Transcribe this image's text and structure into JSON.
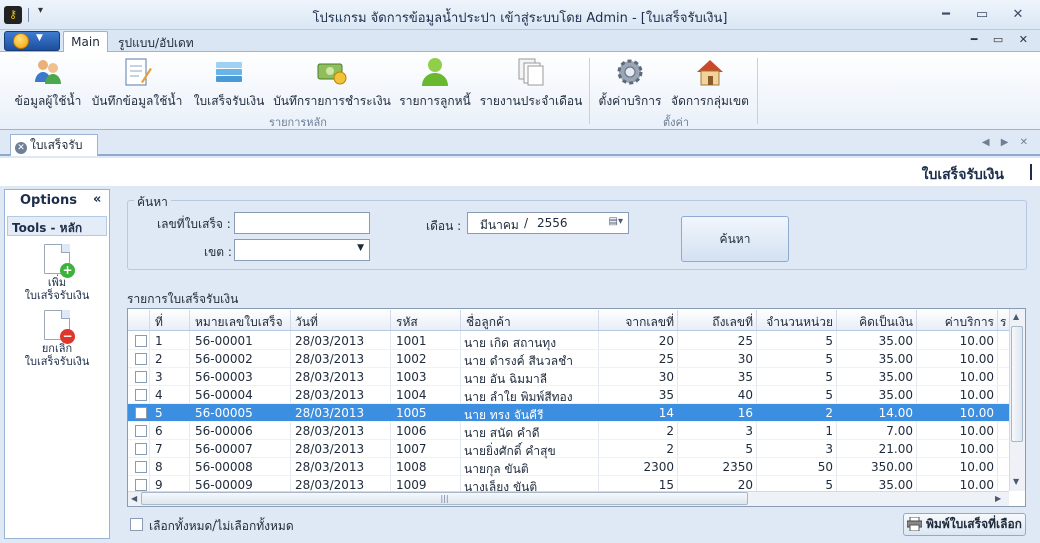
{
  "window": {
    "title": "โปรแกรม จัดการข้อมูลน้ำประปา เข้าสู่ระบบโดย Admin - [ใบเสร็จรับเงิน]",
    "minimize": "━",
    "maximize": "▭",
    "close": "✕"
  },
  "ribbon": {
    "tabs": [
      {
        "label": "Main"
      },
      {
        "label": "รูปแบบ/อัปเดท"
      }
    ],
    "mdi_controls": "━ ▭ ✕",
    "groups": [
      {
        "label": "รายการหลัก",
        "buttons": [
          {
            "label": "ข้อมูลผู้ใช้น้ำ",
            "icon": "users-icon"
          },
          {
            "label": "บันทึกข้อมูลใช้น้ำ",
            "icon": "notebook-pen-icon"
          },
          {
            "label": "ใบเสร็จรับเงิน",
            "icon": "receipt-stack-icon"
          },
          {
            "label": "บันทึกรายการชำระเงิน",
            "icon": "money-icon"
          },
          {
            "label": "รายการลูกหนี้",
            "icon": "debtors-icon"
          },
          {
            "label": "รายงานประจำเดือน",
            "icon": "documents-icon"
          }
        ]
      },
      {
        "label": "ตั้งค่า",
        "buttons": [
          {
            "label": "ตั้งค่าบริการ",
            "icon": "gear-icon"
          },
          {
            "label": "จัดการกลุ่มเขต",
            "icon": "house-icon"
          }
        ]
      }
    ]
  },
  "doc_tab": {
    "label": "ใบเสร็จรับเงิน",
    "nav": "◀ ▶ ✕"
  },
  "form": {
    "title": "ใบเสร็จรับเงิน"
  },
  "left_panel": {
    "options_label": "Options",
    "collapse": "«",
    "tools_header": "Tools  -  หลัก",
    "items": [
      {
        "line1": "เพิ่ม",
        "line2": "ใบเสร็จรับเงิน",
        "badge": "+",
        "badge_color": "#3bb33b"
      },
      {
        "line1": "ยกเลิก",
        "line2": "ใบเสร็จรับเงิน",
        "badge": "−",
        "badge_color": "#e0352b"
      }
    ]
  },
  "search": {
    "legend": "ค้นหา",
    "receipt_no_label": "เลขที่ใบเสร็จ :",
    "receipt_no_value": "",
    "zone_label": "เขต :",
    "zone_value": "",
    "month_label": "เดือน :",
    "month_value": "มีนาคม",
    "year_sep": "/",
    "year_value": "2556",
    "search_button": "ค้นหา"
  },
  "list": {
    "label": "รายการใบเสร็จรับเงิน",
    "columns": [
      "ที่",
      "หมายเลขใบเสร็จ",
      "วันที่",
      "รหัส",
      "ชื่อลูกค้า",
      "จากเลขที่",
      "ถึงเลขที่",
      "จำนวนหน่วย",
      "คิดเป็นเงิน",
      "ค่าบริการ",
      "ร"
    ],
    "rows": [
      [
        "1",
        "56-00001",
        "28/03/2013",
        "1001",
        "นาย เกิด  สถานทุง",
        "20",
        "25",
        "5",
        "35.00",
        "10.00"
      ],
      [
        "2",
        "56-00002",
        "28/03/2013",
        "1002",
        "นาย ดำรงค์  สีนวลชำ",
        "25",
        "30",
        "5",
        "35.00",
        "10.00"
      ],
      [
        "3",
        "56-00003",
        "28/03/2013",
        "1003",
        "นาย อัน  ฉิมมาลี",
        "30",
        "35",
        "5",
        "35.00",
        "10.00"
      ],
      [
        "4",
        "56-00004",
        "28/03/2013",
        "1004",
        "นาย ลำใย  พิมพ์สีทอง",
        "35",
        "40",
        "5",
        "35.00",
        "10.00"
      ],
      [
        "5",
        "56-00005",
        "28/03/2013",
        "1005",
        "นาย ทรง  จันคีรี",
        "14",
        "16",
        "2",
        "14.00",
        "10.00"
      ],
      [
        "6",
        "56-00006",
        "28/03/2013",
        "1006",
        "นาย สนัด  คำดี",
        "2",
        "3",
        "1",
        "7.00",
        "10.00"
      ],
      [
        "7",
        "56-00007",
        "28/03/2013",
        "1007",
        " นายยิ่งศักดิ์  คำสุข",
        "2",
        "5",
        "3",
        "21.00",
        "10.00"
      ],
      [
        "8",
        "56-00008",
        "28/03/2013",
        "1008",
        " นายกุล  ขันติ",
        "2300",
        "2350",
        "50",
        "350.00",
        "10.00"
      ],
      [
        "9",
        "56-00009",
        "28/03/2013",
        "1009",
        " นางเล็ยง  ขันติ",
        "15",
        "20",
        "5",
        "35.00",
        "10.00"
      ]
    ],
    "selected_row_index": 4,
    "select_all_label": "เลือกทั้งหมด/ไม่เลือกทั้งหมด",
    "print_button": "พิมพ์ใบเสร็จที่เลือก"
  }
}
